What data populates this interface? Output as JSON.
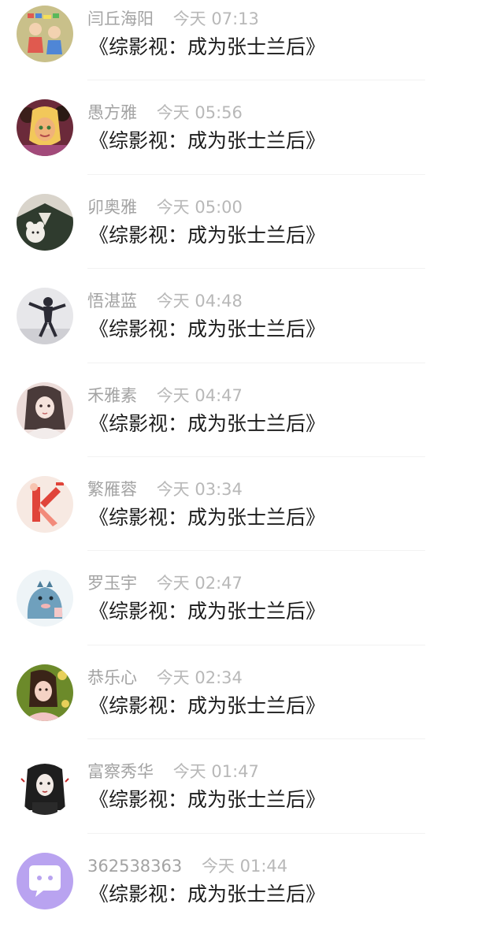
{
  "comments": [
    {
      "name": "闫丘海阳",
      "time": "今天 07:13",
      "message": "《综影视：成为张士兰后》",
      "avatar_icon": "cartoon-kids-avatar",
      "avatar_colors": [
        "#c9c08a",
        "#e05a4f"
      ]
    },
    {
      "name": "愚方雅",
      "time": "今天 05:56",
      "message": "《综影视：成为张士兰后》",
      "avatar_icon": "animated-princesses-avatar",
      "avatar_colors": [
        "#6b2a3a",
        "#f0b27a"
      ]
    },
    {
      "name": "卯奥雅",
      "time": "今天 05:00",
      "message": "《综影视：成为张士兰后》",
      "avatar_icon": "uniform-plush-avatar",
      "avatar_colors": [
        "#2f3b2e",
        "#e8e4dc"
      ]
    },
    {
      "name": "悟湛蓝",
      "time": "今天 04:48",
      "message": "《综影视：成为张士兰后》",
      "avatar_icon": "jumping-person-avatar",
      "avatar_colors": [
        "#e7e7ea",
        "#2b2b35"
      ]
    },
    {
      "name": "禾雅素",
      "time": "今天 04:47",
      "message": "《综影视：成为张士兰后》",
      "avatar_icon": "illustrated-girl-avatar",
      "avatar_colors": [
        "#ecdcd9",
        "#4a3b3a"
      ]
    },
    {
      "name": "繁雁蓉",
      "time": "今天 03:34",
      "message": "《综影视：成为张士兰后》",
      "avatar_icon": "red-figure-illustration-avatar",
      "avatar_colors": [
        "#f7e9e2",
        "#e0443a"
      ]
    },
    {
      "name": "罗玉宇",
      "time": "今天 02:47",
      "message": "《综影视：成为张士兰后》",
      "avatar_icon": "blue-dinosaur-avatar",
      "avatar_colors": [
        "#eef4f7",
        "#6fa0bd"
      ]
    },
    {
      "name": "恭乐心",
      "time": "今天 02:34",
      "message": "《综影视：成为张士兰后》",
      "avatar_icon": "girl-with-flowers-avatar",
      "avatar_colors": [
        "#6c8a2a",
        "#f4d2c4"
      ]
    },
    {
      "name": "富察秀华",
      "time": "今天 01:47",
      "message": "《综影视：成为张士兰后》",
      "avatar_icon": "dark-haired-girl-avatar",
      "avatar_colors": [
        "#ffffff",
        "#1e1e1e"
      ]
    },
    {
      "name": "362538363",
      "time": "今天 01:44",
      "message": "《综影视：成为张士兰后》",
      "avatar_icon": "chat-bubble-avatar",
      "avatar_colors": [
        "#b9a3f0",
        "#ffffff"
      ]
    }
  ]
}
